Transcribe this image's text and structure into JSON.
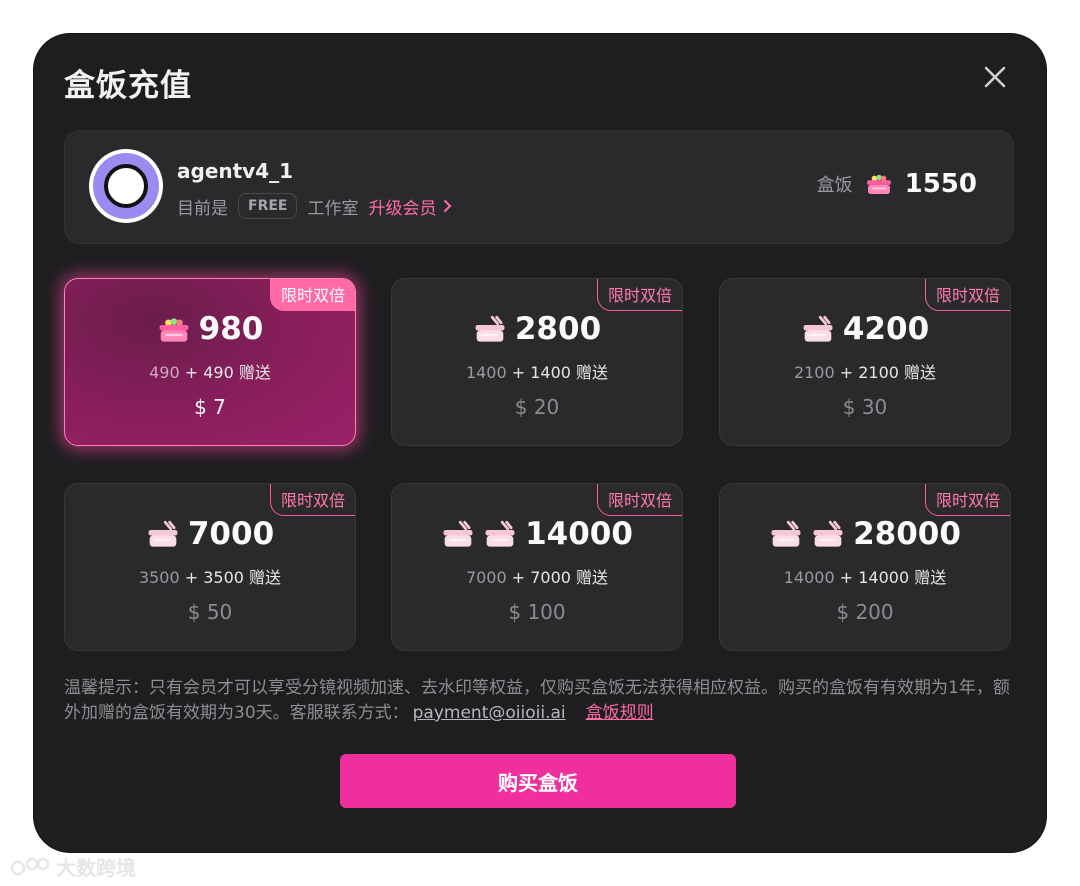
{
  "dialog": {
    "title": "盒饭充值",
    "close_icon": "close-icon"
  },
  "user": {
    "name": "agentv4_1",
    "status_prefix": "目前是",
    "plan_badge": "FREE",
    "studio_label": "工作室",
    "upgrade_label": "升级会员"
  },
  "balance": {
    "label": "盒饭",
    "value": "1550",
    "icon": "bento-icon"
  },
  "packages": [
    {
      "badge": "限时双倍",
      "amount": "980",
      "base": "490",
      "bonus": "+ 490 赠送",
      "price": "$ 7",
      "icons": 1,
      "selected": true
    },
    {
      "badge": "限时双倍",
      "amount": "2800",
      "base": "1400",
      "bonus": "+ 1400 赠送",
      "price": "$ 20",
      "icons": 1,
      "selected": false
    },
    {
      "badge": "限时双倍",
      "amount": "4200",
      "base": "2100",
      "bonus": "+ 2100 赠送",
      "price": "$ 30",
      "icons": 1,
      "selected": false
    },
    {
      "badge": "限时双倍",
      "amount": "7000",
      "base": "3500",
      "bonus": "+ 3500 赠送",
      "price": "$ 50",
      "icons": 1,
      "selected": false
    },
    {
      "badge": "限时双倍",
      "amount": "14000",
      "base": "7000",
      "bonus": "+ 7000 赠送",
      "price": "$ 100",
      "icons": 2,
      "selected": false
    },
    {
      "badge": "限时双倍",
      "amount": "28000",
      "base": "14000",
      "bonus": "+ 14000 赠送",
      "price": "$ 200",
      "icons": 2,
      "selected": false
    }
  ],
  "note": {
    "text": "温馨提示：只有会员才可以享受分镜视频加速、去水印等权益，仅购买盒饭无法获得相应权益。购买的盒饭有有效期为1年，额外加赠的盒饭有效期为30天。客服联系方式：",
    "email": "payment@oiioii.ai",
    "rules_link": "盒饭规则"
  },
  "buy_button": "购买盒饭",
  "watermark": "大数跨境",
  "colors": {
    "accent": "#ee2f9c",
    "pink_text": "#ff6aa8",
    "modal_bg": "#1e1e20",
    "card_bg": "#2a2a2d"
  }
}
